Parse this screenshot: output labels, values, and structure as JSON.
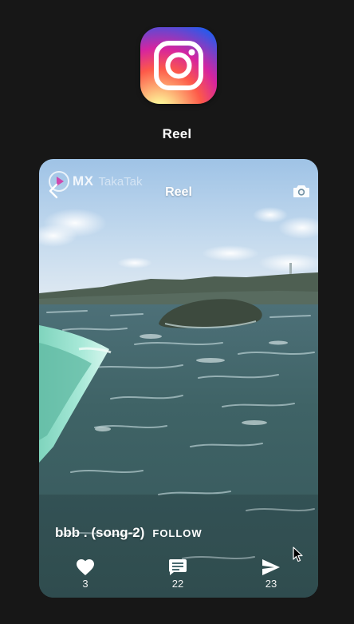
{
  "app": {
    "logo_icon": "instagram-logo-icon",
    "title": "Reel"
  },
  "reel": {
    "header_title": "Reel",
    "watermark": {
      "brand": "MX",
      "product": "TakaTak"
    },
    "song_label": "bbb . (song-2)",
    "follow_label": "FOLLOW",
    "actions": {
      "like": {
        "icon": "heart-icon",
        "count": "3"
      },
      "comment": {
        "icon": "comment-icon",
        "count": "22"
      },
      "share": {
        "icon": "send-icon",
        "count": "23"
      }
    }
  },
  "colors": {
    "page_background": "#171717",
    "text": "#ffffff"
  }
}
